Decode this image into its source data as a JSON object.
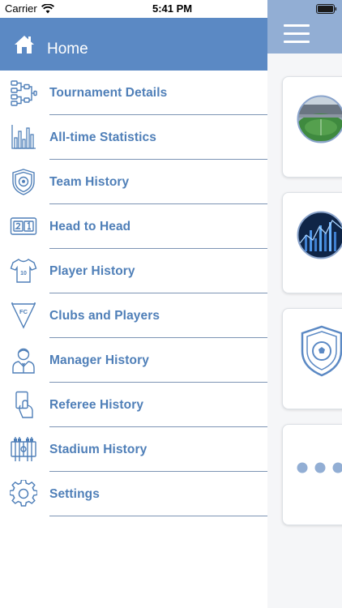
{
  "status_bar": {
    "carrier": "Carrier",
    "time": "5:41 PM"
  },
  "drawer": {
    "header": {
      "label": "Home",
      "icon": "home-icon"
    },
    "items": [
      {
        "label": "Tournament Details",
        "icon": "bracket-icon"
      },
      {
        "label": "All-time Statistics",
        "icon": "bar-chart-icon"
      },
      {
        "label": "Team History",
        "icon": "team-shield-icon"
      },
      {
        "label": "Head to Head",
        "icon": "scoreboard-icon"
      },
      {
        "label": "Player History",
        "icon": "jersey-icon"
      },
      {
        "label": "Clubs and Players",
        "icon": "pennant-icon"
      },
      {
        "label": "Manager History",
        "icon": "manager-icon"
      },
      {
        "label": "Referee History",
        "icon": "referee-card-icon"
      },
      {
        "label": "Stadium History",
        "icon": "foosball-icon"
      },
      {
        "label": "Settings",
        "icon": "gear-icon"
      }
    ]
  },
  "content": {
    "cards": [
      {
        "icon": "stadium-image"
      },
      {
        "icon": "statistics-image"
      },
      {
        "icon": "team-shield-icon"
      },
      {
        "icon": "more-dots-icon"
      }
    ]
  },
  "colors": {
    "drawer_header": "#5b89c4",
    "content_header": "#92aed4",
    "menu_text": "#4f7fb8",
    "divider": "#7c94b4"
  }
}
